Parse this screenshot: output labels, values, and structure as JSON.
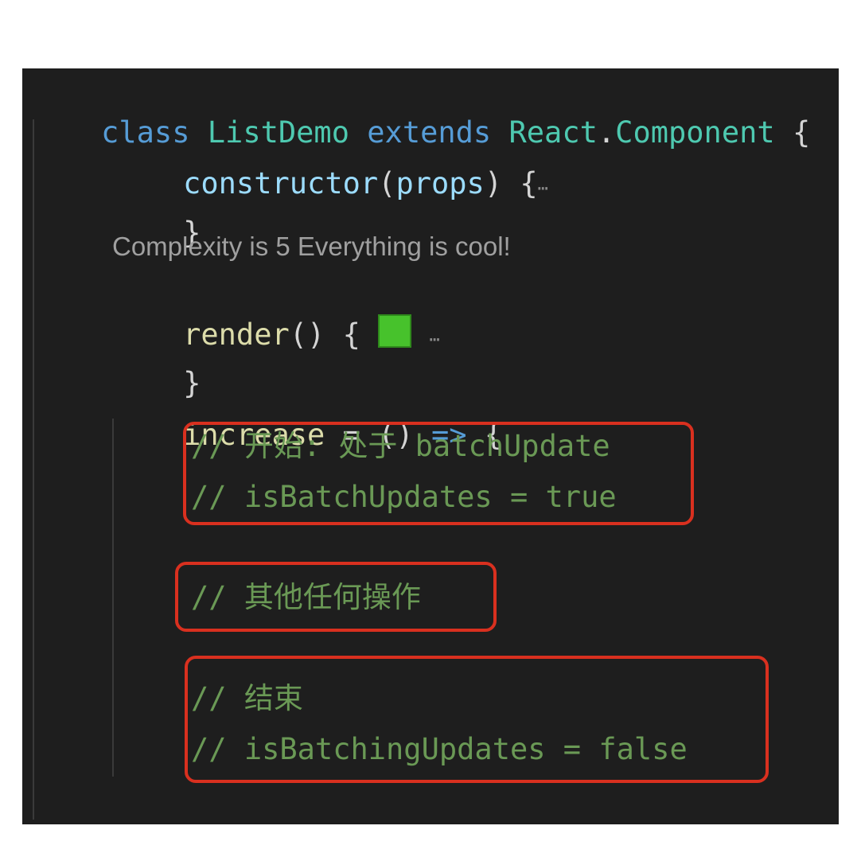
{
  "editor": {
    "background": "#1e1e1e",
    "class_decl": {
      "keyword_class": "class",
      "class_name": "ListDemo",
      "keyword_extends": "extends",
      "parent_object": "React",
      "dot": ".",
      "parent_member": "Component",
      "open_brace": "{"
    },
    "constructor": {
      "name": "constructor",
      "open_paren": "(",
      "param": "props",
      "close_paren_brace": ") {",
      "fold_marker": "…",
      "close_brace": "}"
    },
    "codelens": {
      "text": "Complexity is 5 Everything is cool!"
    },
    "render": {
      "name": "render",
      "signature": "() {",
      "swatch_color": "#47c22c",
      "fold_marker": "…",
      "close_brace": "}"
    },
    "increase": {
      "name": "increase",
      "assign": " = () ",
      "arrow": "=>",
      "open_brace": " {",
      "close_brace": "}"
    },
    "comments": {
      "start_line1": "// 开始: 处于 batchUpdate",
      "start_line2": "// isBatchUpdates = true",
      "other": "// 其他任何操作",
      "end_line1": "// 结束",
      "end_line2": "// isBatchingUpdates = false"
    },
    "colors": {
      "keyword": "#569cd6",
      "class_name": "#4ec9b0",
      "function": "#dcdcaa",
      "variable": "#9cdcfe",
      "comment": "#6a9955",
      "highlight_box": "#d9301f"
    }
  }
}
